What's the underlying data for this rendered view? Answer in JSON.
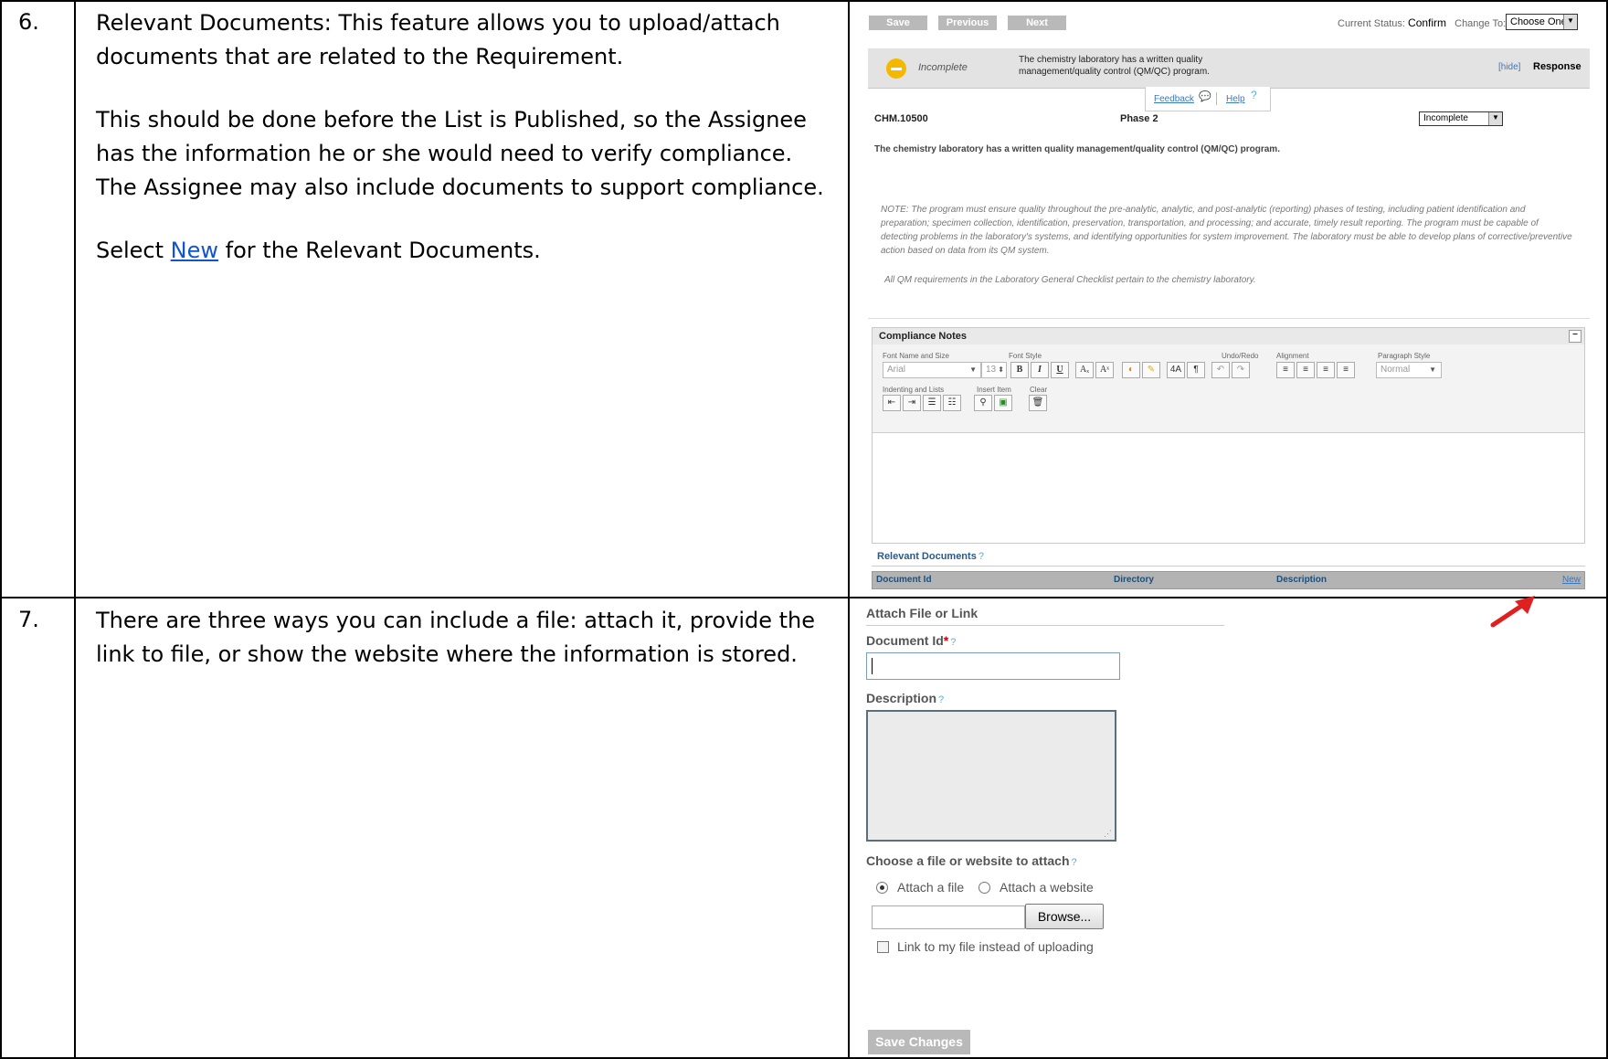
{
  "rows": [
    {
      "number": "6.",
      "paragraphs": [
        "Relevant Documents: This feature allows you to upload/attach documents that are related to the Requirement.",
        "This should be done before the List is Published, so the Assignee has the information he or she would need to verify compliance. The Assignee may also include documents to support compliance."
      ],
      "select_prefix": "Select ",
      "select_link": "New",
      "select_suffix": " for the Relevant Documents."
    },
    {
      "number": "7.",
      "paragraphs": [
        "There are three ways you can include a file:  attach it, provide the link to file, or show the website where the information is stored."
      ]
    }
  ],
  "screenshot1": {
    "toolbar": {
      "save": "Save",
      "previous": "Previous",
      "next": "Next"
    },
    "status_label": "Current Status:",
    "status_value": "Confirm",
    "change_to_label": "Change To:",
    "change_to_value": "Choose One",
    "banner": {
      "state": "Incomplete",
      "text": "The chemistry laboratory has a written quality management/quality control (QM/QC) program.",
      "hide": "[hide]",
      "response": "Response"
    },
    "feedback": "Feedback",
    "help": "Help",
    "requirement_id": "CHM.10500",
    "phase": "Phase 2",
    "status_select": "Incomplete",
    "requirement_text": "The chemistry laboratory has a written quality management/quality control (QM/QC) program.",
    "note": "NOTE:  The program must ensure quality throughout the pre-analytic, analytic, and post-analytic (reporting) phases of testing, including patient identification and preparation; specimen collection, identification, preservation, transportation, and processing; and accurate, timely result reporting.  The program must be capable of detecting problems in the laboratory's systems, and identifying opportunities for system improvement.  The laboratory must be able to develop plans of corrective/preventive action based on data from its QM system.",
    "note2": "All QM requirements in the Laboratory General Checklist pertain to the chemistry laboratory.",
    "compliance_notes": "Compliance Notes",
    "editor": {
      "font_label": "Font Name and Size",
      "font_value": "Arial",
      "size_value": "13",
      "style_label": "Font Style",
      "undo_label": "Undo/Redo",
      "align_label": "Alignment",
      "para_label": "Paragraph Style",
      "para_value": "Normal",
      "indent_label": "Indenting and Lists",
      "insert_label": "Insert Item",
      "clear_label": "Clear"
    },
    "relevant_documents": "Relevant Documents",
    "columns": {
      "doc_id": "Document Id",
      "directory": "Directory",
      "description": "Description",
      "new": "New"
    }
  },
  "screenshot2": {
    "title": "Attach File or Link",
    "doc_id_label": "Document Id",
    "required": "*",
    "description_label": "Description",
    "choose_label": "Choose a file or website to attach",
    "attach_file": "Attach a file",
    "attach_website": "Attach a website",
    "browse": "Browse...",
    "link_instead": "Link to my file instead of uploading",
    "save_changes": "Save Changes"
  },
  "colors": {
    "link": "#1155cc",
    "arrow": "#e02020",
    "help": "#5ab0d6"
  }
}
